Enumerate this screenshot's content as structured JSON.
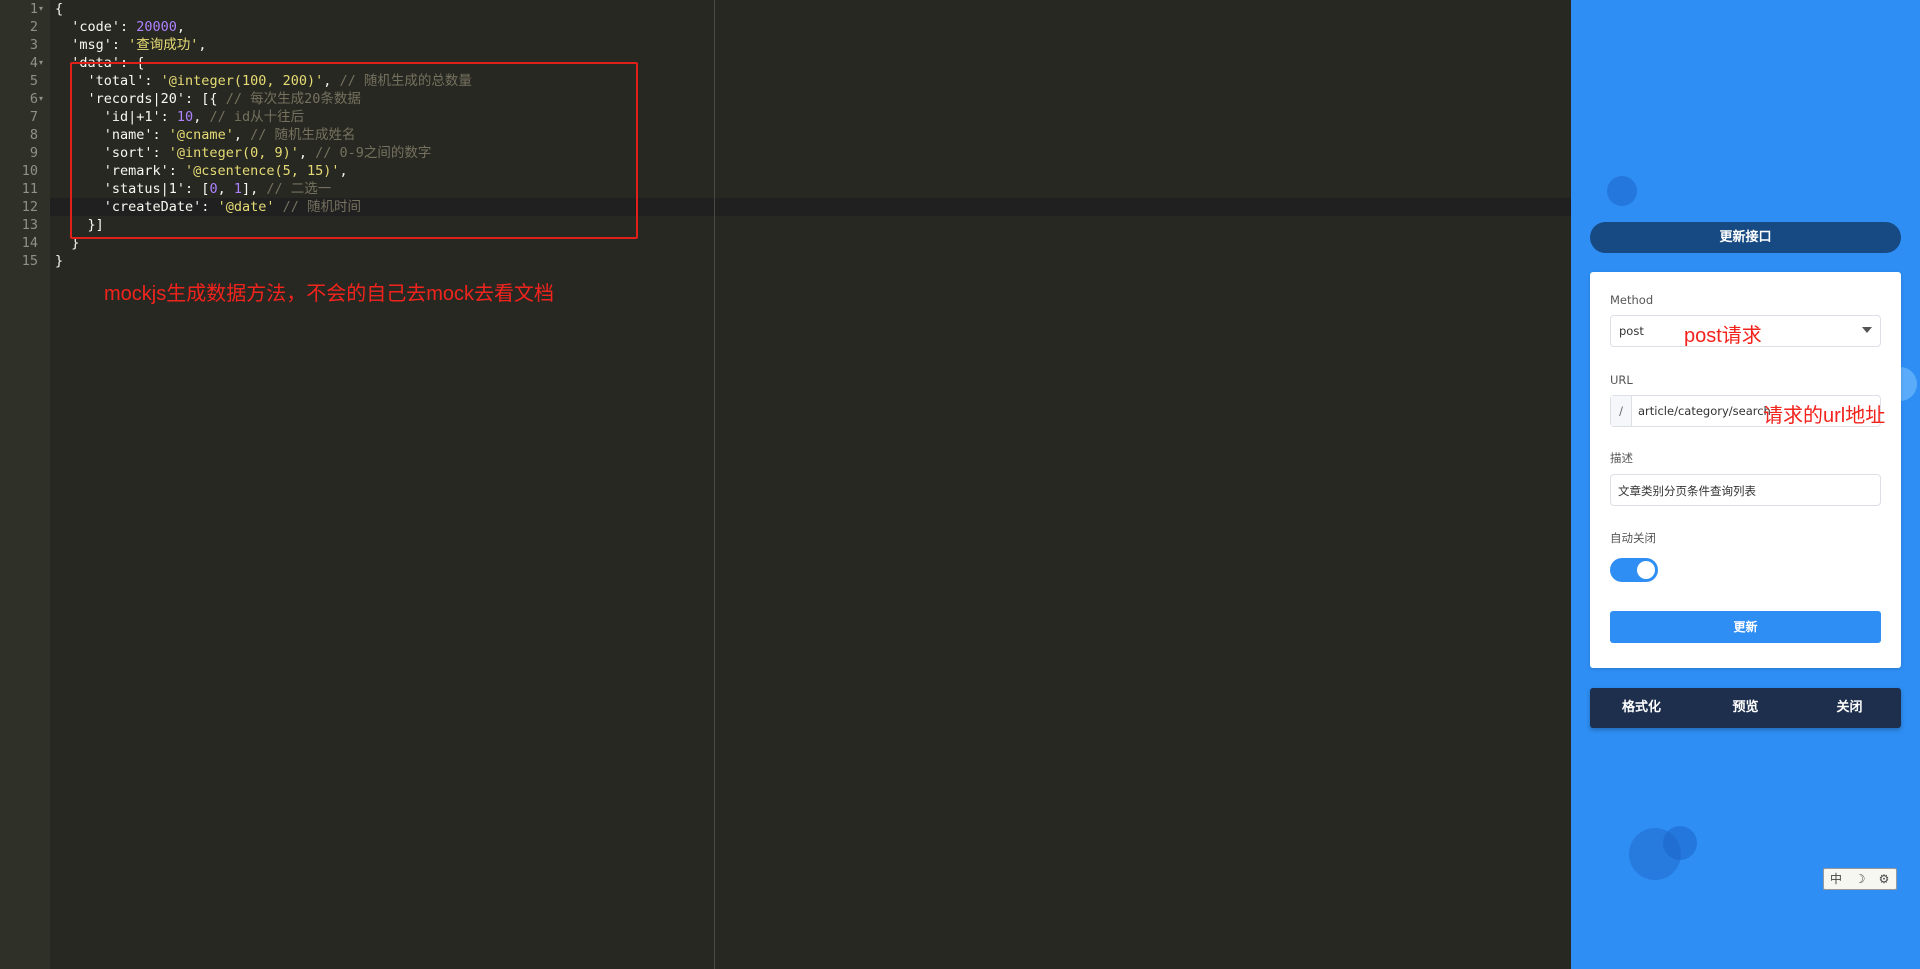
{
  "editor": {
    "line_numbers": [
      "1",
      "2",
      "3",
      "4",
      "5",
      "6",
      "7",
      "8",
      "9",
      "10",
      "11",
      "12",
      "13",
      "14",
      "15"
    ],
    "lines": [
      [
        {
          "t": "p",
          "v": "{"
        }
      ],
      [
        {
          "t": "p",
          "v": "  'code': "
        },
        {
          "t": "n",
          "v": "20000"
        },
        {
          "t": "p",
          "v": ","
        }
      ],
      [
        {
          "t": "p",
          "v": "  'msg': "
        },
        {
          "t": "s",
          "v": "'查询成功'"
        },
        {
          "t": "p",
          "v": ","
        }
      ],
      [
        {
          "t": "p",
          "v": "  'data': {"
        }
      ],
      [
        {
          "t": "p",
          "v": "    'total': "
        },
        {
          "t": "s",
          "v": "'@integer(100, 200)'"
        },
        {
          "t": "p",
          "v": ", "
        },
        {
          "t": "c",
          "v": "// 随机生成的总数量"
        }
      ],
      [
        {
          "t": "p",
          "v": "    'records|20': [{ "
        },
        {
          "t": "c",
          "v": "// 每次生成20条数据"
        }
      ],
      [
        {
          "t": "p",
          "v": "      'id|+1': "
        },
        {
          "t": "n",
          "v": "10"
        },
        {
          "t": "p",
          "v": ", "
        },
        {
          "t": "c",
          "v": "// id从十往后"
        }
      ],
      [
        {
          "t": "p",
          "v": "      'name': "
        },
        {
          "t": "s",
          "v": "'@cname'"
        },
        {
          "t": "p",
          "v": ", "
        },
        {
          "t": "c",
          "v": "// 随机生成姓名"
        }
      ],
      [
        {
          "t": "p",
          "v": "      'sort': "
        },
        {
          "t": "s",
          "v": "'@integer(0, 9)'"
        },
        {
          "t": "p",
          "v": ", "
        },
        {
          "t": "c",
          "v": "// 0-9之间的数字"
        }
      ],
      [
        {
          "t": "p",
          "v": "      'remark': "
        },
        {
          "t": "s",
          "v": "'@csentence(5, 15)'"
        },
        {
          "t": "p",
          "v": ","
        }
      ],
      [
        {
          "t": "p",
          "v": "      'status|1': ["
        },
        {
          "t": "n",
          "v": "0"
        },
        {
          "t": "p",
          "v": ", "
        },
        {
          "t": "n",
          "v": "1"
        },
        {
          "t": "p",
          "v": "], "
        },
        {
          "t": "c",
          "v": "// 二选一"
        }
      ],
      [
        {
          "t": "p",
          "v": "      'createDate': "
        },
        {
          "t": "s",
          "v": "'@date'"
        },
        {
          "t": "p",
          "v": " "
        },
        {
          "t": "c",
          "v": "// 随机时间"
        }
      ],
      [
        {
          "t": "p",
          "v": "    }]"
        }
      ],
      [
        {
          "t": "p",
          "v": "  }"
        }
      ],
      [
        {
          "t": "p",
          "v": "}"
        }
      ]
    ],
    "annotation": "mockjs生成数据方法，不会的自己去mock去看文档"
  },
  "panel": {
    "title": "更新接口",
    "method_label": "Method",
    "method_value": "post",
    "method_annotation": "post请求",
    "url_label": "URL",
    "url_prefix": "/",
    "url_value": "article/category/search",
    "url_annotation": "请求的url地址",
    "desc_label": "描述",
    "desc_value": "文章类别分页条件查询列表",
    "autoclose_label": "自动关闭",
    "autoclose_on": true,
    "update_button": "更新",
    "actions": [
      "格式化",
      "预览",
      "关闭"
    ]
  },
  "ime": {
    "chars": [
      "中",
      "☽",
      "⚙"
    ]
  },
  "colors": {
    "editor_bg": "#272822",
    "panel_bg": "#2e8ef3",
    "annotation_red": "#f2231d",
    "title_bar": "#174a82",
    "action_bar": "#1e2f4d"
  }
}
